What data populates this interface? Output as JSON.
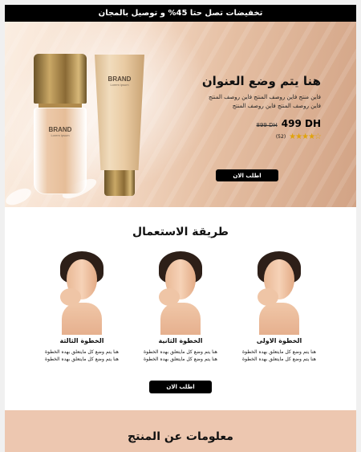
{
  "topbar": {
    "text": "تخفيضات تصل حتا 45% و توصيل بالمجان"
  },
  "hero": {
    "title": "هنا يتم وضع العنوان",
    "description_line1": "فاين منتج فاين روصف المنتج فاين روصف المنتج",
    "description_line2": "فاين روصف المنتج فاين روصف المنتج",
    "new_price": "499 DH",
    "old_price": "899 DH",
    "rating_stars": "★★★★☆",
    "rating_count": "(52)",
    "cta_label": "اطلب الان",
    "product_brand": "BRAND",
    "product_brand_sub": "Lorem ipsum"
  },
  "usage": {
    "title": "طريقة الاستعمال",
    "steps": [
      {
        "title": "الخطوة الاولى",
        "desc": "هنا يتم وضع كل مايتعلق بهده الخطوة هنا يتم وضع كل مايتعلق بهده الخطوة"
      },
      {
        "title": "الخطوة الثانية",
        "desc": "هنا يتم وضع كل مايتعلق بهده الخطوة هنا يتم وضع كل مايتعلق بهده الخطوة"
      },
      {
        "title": "الخطوة الثالثة",
        "desc": "هنا يتم وضع كل مايتعلق بهده الخطوة هنا يتم وضع كل مايتعلق بهده الخطوة"
      }
    ],
    "cta_label": "اطلب الان"
  },
  "info": {
    "title": "معلومات عن المنتج"
  },
  "colors": {
    "accent": "#000000",
    "hero_bg": "#e8c4a8",
    "info_bg": "#edc7b0",
    "star": "#e0a30c"
  }
}
